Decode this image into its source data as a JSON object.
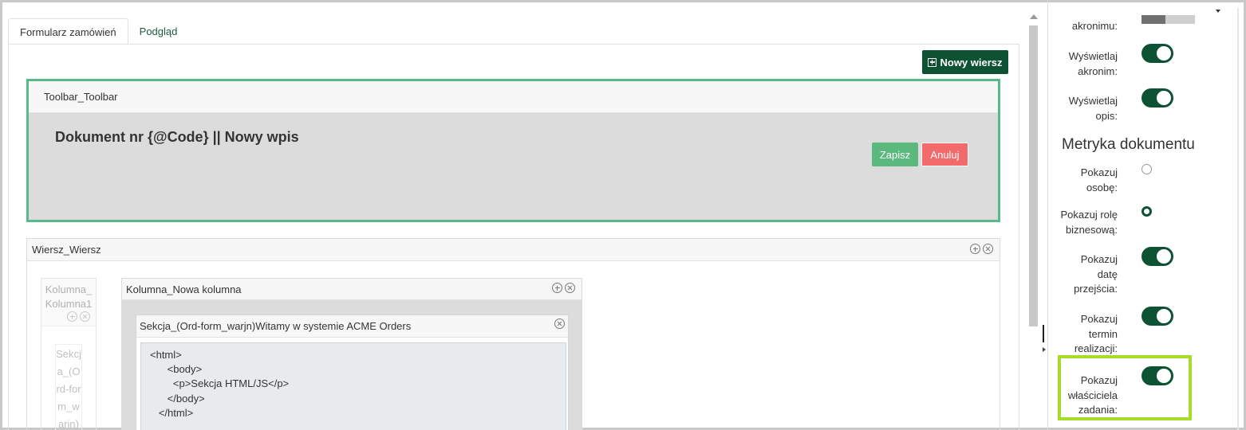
{
  "tabs": [
    {
      "label": "Formularz zamówień",
      "active": true
    },
    {
      "label": "Podgląd",
      "active": false
    }
  ],
  "toolbar": {
    "new_row_label": "Nowy wiersz"
  },
  "toolbar_block": {
    "header": "Toolbar_Toolbar",
    "title": "Dokument nr {@Code} || Nowy wpis",
    "save_label": "Zapisz",
    "cancel_label": "Anuluj"
  },
  "row_block": {
    "header": "Wiersz_Wiersz"
  },
  "column1": {
    "header": "Kolumna_ Kolumna1",
    "section_text": "Sekcja_(Ord-form_warjn)"
  },
  "column2": {
    "header": "Kolumna_Nowa kolumna",
    "section": {
      "header": "Sekcja_(Ord-form_warjn)Witamy w systemie ACME Orders",
      "code_lines": [
        "<html>",
        "      <body>",
        "        <p>Sekcja HTML/JS</p>",
        "      </body>",
        "   </html>"
      ]
    }
  },
  "side_panel": {
    "acronym_label": "akronimu:",
    "show_acronym_label": "Wyświetlaj akronim:",
    "show_acronym_on": true,
    "show_description_label": "Wyświetlaj opis:",
    "show_description_on": true,
    "metrics_title": "Metryka dokumentu",
    "show_person_label": "Pokazuj osobę:",
    "show_person_selected": false,
    "show_business_role_label": "Pokazuj rolę biznesową:",
    "show_business_role_selected": true,
    "show_transition_date_label": "Pokazuj datę przejścia:",
    "show_transition_date_on": true,
    "show_deadline_label": "Pokazuj termin realizacji:",
    "show_deadline_on": true,
    "show_task_owner_label": "Pokazuj właściciela zadania:",
    "show_task_owner_on": true
  },
  "colors": {
    "primary": "#0d5233",
    "save": "#5cb97e",
    "cancel": "#f26a6a",
    "toolbar_border": "#58b98c",
    "highlight": "#a8dc2b"
  }
}
